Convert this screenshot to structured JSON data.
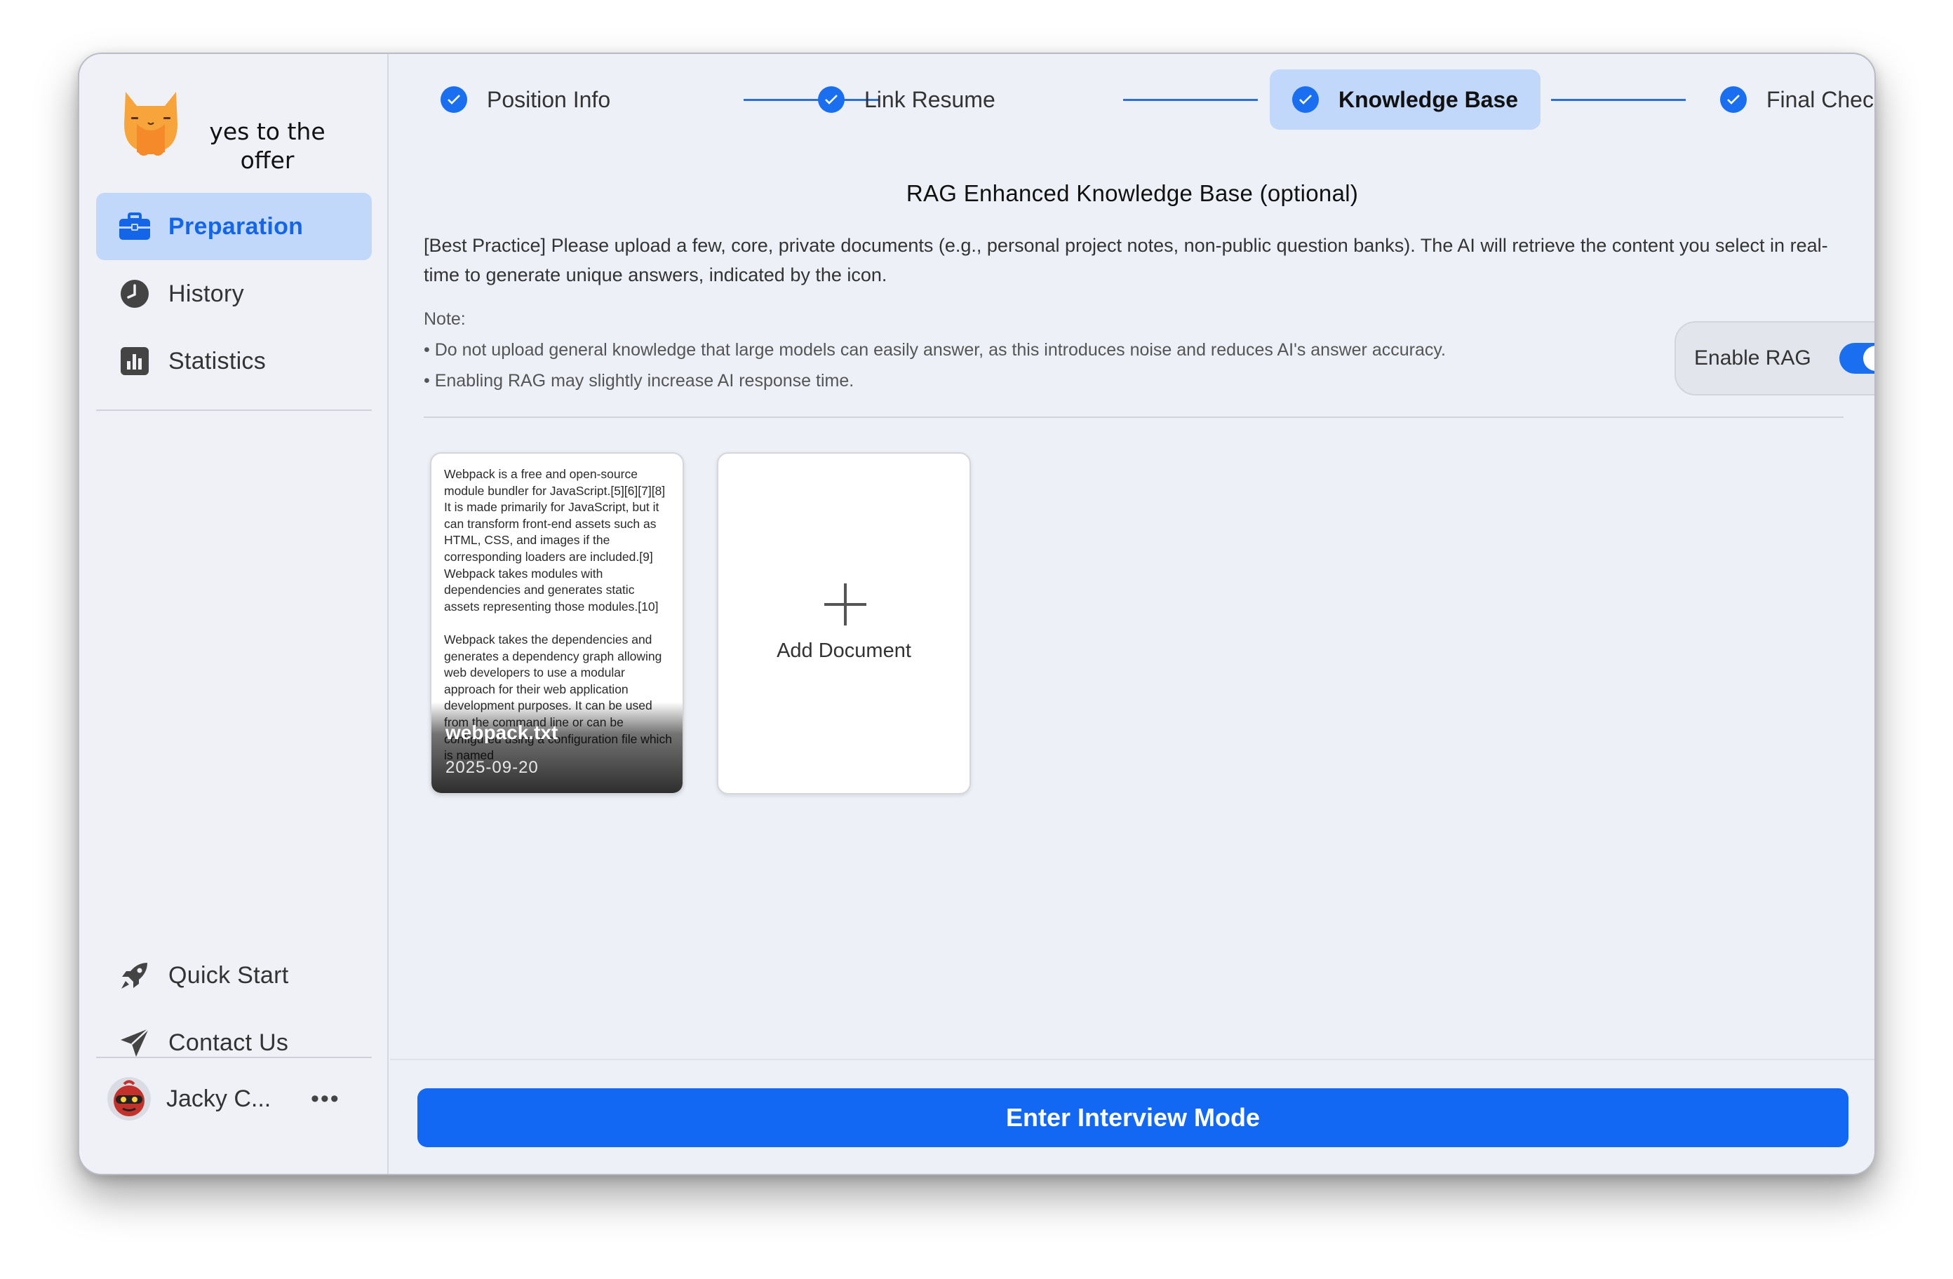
{
  "app": {
    "logo_text": "yes to the offer",
    "brand_color": "#1a6ff0"
  },
  "sidebar": {
    "items": [
      {
        "label": "Preparation",
        "icon": "briefcase-icon",
        "active": true
      },
      {
        "label": "History",
        "icon": "clock-icon",
        "active": false
      },
      {
        "label": "Statistics",
        "icon": "bar-chart-icon",
        "active": false
      }
    ],
    "bottom_items": [
      {
        "label": "Quick Start",
        "icon": "rocket-icon"
      },
      {
        "label": "Contact Us",
        "icon": "paper-plane-icon"
      }
    ],
    "user": {
      "name": "Jacky C...",
      "more": "•••"
    }
  },
  "stepper": {
    "steps": [
      {
        "label": "Position Info",
        "state": "done"
      },
      {
        "label": "Link Resume",
        "state": "done"
      },
      {
        "label": "Knowledge Base",
        "state": "current"
      },
      {
        "label": "Final Check",
        "state": "done"
      }
    ]
  },
  "knowledge": {
    "title": "RAG Enhanced Knowledge Base (optional)",
    "description": "[Best Practice] Please upload a few, core, private documents (e.g., personal project notes, non-public question banks). The AI will retrieve the content you select in real-time to generate unique answers, indicated by the  icon.",
    "note_label": "Note:",
    "notes": [
      "• Do not upload general knowledge that large models can easily answer, as this introduces noise and reduces AI's answer accuracy.",
      "• Enabling RAG may slightly increase AI response time."
    ],
    "rag_toggle": {
      "label": "Enable RAG",
      "enabled": true
    }
  },
  "documents": [
    {
      "name": "webpack.txt",
      "date": "2025-09-20",
      "preview": "Webpack is a free and open-source module bundler for JavaScript.[5][6][7][8] It is made primarily for JavaScript, but it can transform front-end assets such as HTML, CSS, and images if the corresponding loaders are included.[9] Webpack takes modules with dependencies and generates static assets representing those modules.[10]\n\nWebpack takes the dependencies and generates a dependency graph allowing web developers to use a modular approach for their web application development purposes. It can be used from the command line or can be configured using a configuration file which is named"
    }
  ],
  "add_document": {
    "label": "Add Document"
  },
  "footer": {
    "enter_button": "Enter Interview Mode"
  }
}
